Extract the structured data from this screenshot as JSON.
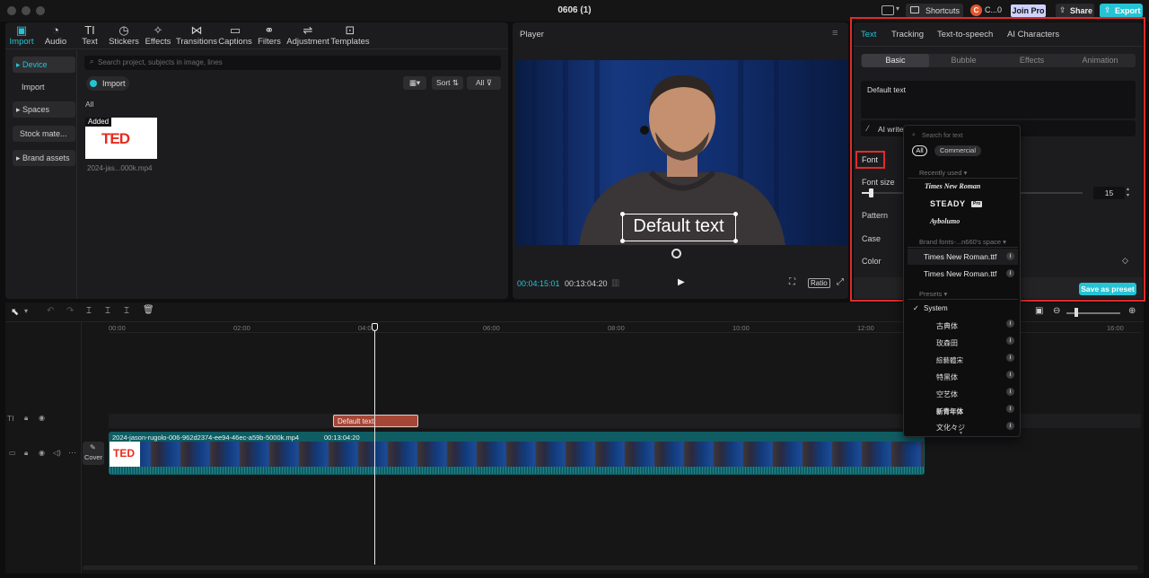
{
  "window": {
    "title": "0606 (1)"
  },
  "topbar": {
    "shortcuts": "Shortcuts",
    "user": "C...0",
    "avatar_initial": "C",
    "join_pro": "Join Pro",
    "share": "Share",
    "export": "Export"
  },
  "media_tabs": [
    {
      "label": "Import",
      "icon": "import-icon"
    },
    {
      "label": "Audio",
      "icon": "audio-icon"
    },
    {
      "label": "Text",
      "icon": "text-icon"
    },
    {
      "label": "Stickers",
      "icon": "stickers-icon"
    },
    {
      "label": "Effects",
      "icon": "effects-icon"
    },
    {
      "label": "Transitions",
      "icon": "transitions-icon"
    },
    {
      "label": "Captions",
      "icon": "captions-icon"
    },
    {
      "label": "Filters",
      "icon": "filters-icon"
    },
    {
      "label": "Adjustment",
      "icon": "adjustment-icon"
    },
    {
      "label": "Templates",
      "icon": "templates-icon"
    }
  ],
  "sidebar": {
    "device": "Device",
    "import": "Import",
    "spaces": "Spaces",
    "stock": "Stock mate...",
    "brand": "Brand assets"
  },
  "media": {
    "search_placeholder": "Search project, subjects in image, lines",
    "import_btn": "Import",
    "sort": "Sort",
    "all_filter": "All",
    "all_label": "All",
    "added_badge": "Added",
    "thumb_logo": "TED",
    "file_name": "2024-jas...000k.mp4"
  },
  "player": {
    "title": "Player",
    "overlay_text": "Default text",
    "current_time": "00:04:15:01",
    "total_time": "00:13:04:20",
    "ratio": "Ratio"
  },
  "props": {
    "tabs": [
      "Text",
      "Tracking",
      "Text-to-speech",
      "AI Characters"
    ],
    "subtabs": [
      "Basic",
      "Bubble",
      "Effects",
      "Animation"
    ],
    "text_value": "Default text",
    "ai_writer": "AI writer",
    "font_label": "Font",
    "font_size_label": "Font size",
    "font_size_value": "15",
    "font_size_fraction": 0.04,
    "pattern_label": "Pattern",
    "case_label": "Case",
    "color_label": "Color",
    "save_preset": "Save as preset"
  },
  "font_dropdown": {
    "search_placeholder": "Search for text",
    "filter_all": "All",
    "filter_commercial": "Commercial",
    "recently_used": "Recently used",
    "recent": [
      "Times New Roman",
      "STEADY",
      "Aybolumo"
    ],
    "steady_badge": "Pro",
    "brand_fonts": "Brand fonts-...n660's space",
    "brand": [
      "Times New Roman.ttf",
      "Times New Roman.ttf"
    ],
    "presets": "Presets",
    "system": "System",
    "preset_fonts": [
      "古典体",
      "玫森田",
      "綜藝體宋",
      "特黑体",
      "空艺体",
      "新青年体",
      "文化々ジ"
    ]
  },
  "timeline": {
    "ruler": [
      "00:00",
      "02:00",
      "04:00",
      "06:00",
      "08:00",
      "10:00",
      "12:00",
      "16:00"
    ],
    "text_clip": "Default text",
    "video_clip_name": "2024-jason-rugolo-006-962d2374-ee94-46ec-a59b-5000k.mp4",
    "video_clip_duration": "00:13:04:20",
    "cover": "Cover",
    "thumb_logo": "TED"
  },
  "colors": {
    "accent": "#25c3d4",
    "highlight_red": "#e02b2b",
    "ted_red": "#e62b1e",
    "text_clip": "#a54637",
    "video_clip": "#0f5d63",
    "join_pro": "#cfd2ff"
  }
}
